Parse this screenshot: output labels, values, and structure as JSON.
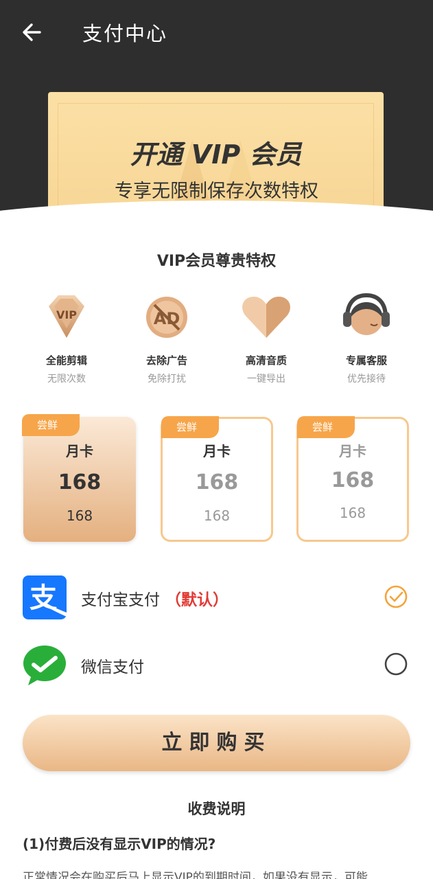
{
  "topbar": {
    "title": "支付中心"
  },
  "banner": {
    "title": "开通 VIP 会员",
    "subtitle": "专享无限制保存次数特权"
  },
  "privileges": {
    "title": "VIP会员尊贵特权",
    "items": [
      {
        "name": "全能剪辑",
        "desc": "无限次数",
        "icon": "vip-diamond-icon"
      },
      {
        "name": "去除广告",
        "desc": "免除打扰",
        "icon": "no-ad-icon"
      },
      {
        "name": "高清音质",
        "desc": "一键导出",
        "icon": "heart-icon"
      },
      {
        "name": "专属客服",
        "desc": "优先接待",
        "icon": "headset-icon"
      }
    ]
  },
  "plans": [
    {
      "tag": "尝鲜",
      "name": "月卡",
      "price": "168",
      "original": "168",
      "selected": true
    },
    {
      "tag": "尝鲜",
      "name": "月卡",
      "price": "168",
      "original": "168",
      "selected": false
    },
    {
      "tag": "尝鲜",
      "name": "月卡",
      "price": "168",
      "original": "168",
      "selected": false
    }
  ],
  "payment": {
    "alipay": {
      "label": "支付宝支付",
      "default_text": "（默认）",
      "checked": true
    },
    "wechat": {
      "label": "微信支付",
      "checked": false
    }
  },
  "buy_button": {
    "label": "立即购买"
  },
  "fee_info": {
    "title": "收费说明",
    "q1": "(1)付费后没有显示VIP的情况?",
    "a1": "正常情况会在购买后马上显示VIP的到期时间，如果没有显示，可能"
  },
  "colors": {
    "header_dark": "#2e2e2e",
    "accent_orange": "#f7a54a",
    "card_gold": "#f7d594",
    "default_red": "#e23b35"
  }
}
